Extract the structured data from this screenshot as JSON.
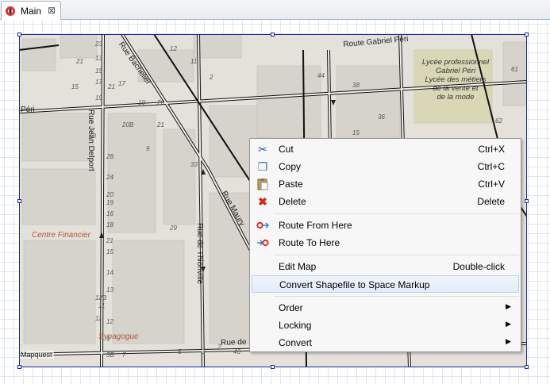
{
  "tab": {
    "label": "Main",
    "close": "⊠"
  },
  "map": {
    "labels": {
      "centre_financier": "Centre Financier",
      "synagogue": "Synagogue",
      "lycee": [
        "Lycée professionnel",
        "Gabriel Péri",
        "Lycée des métiers",
        "de la vente et",
        "de la mode"
      ],
      "mapquest": "Mapquest"
    },
    "streets": {
      "gabriel_peri": "Route Gabriel Péri",
      "jean_delport": "Rue Jean Delport",
      "thionville": "Rue de Thionville",
      "maury": "Rue Maury",
      "bachelier": "Rue Bachelier",
      "bottom": "Rue de",
      "peri_left": "Péri"
    },
    "numbers": [
      "23",
      "21",
      "15",
      "13",
      "15",
      "17",
      "19",
      "21",
      "17",
      "19",
      "20",
      "20B",
      "18",
      "28",
      "24",
      "20",
      "19",
      "16",
      "18",
      "21",
      "15",
      "14",
      "13",
      "11",
      "12",
      "12B",
      "11",
      "9",
      "3B",
      "7",
      "5",
      "3",
      "2",
      "46",
      "25",
      "28",
      "44",
      "38",
      "36",
      "15",
      "62",
      "61",
      "54",
      "48",
      "46",
      "9",
      "21",
      "12",
      "11",
      "2",
      "33",
      "29"
    ]
  },
  "menu": {
    "items": [
      {
        "label": "Cut",
        "accel": "Ctrl+X",
        "icon": "scissors-icon",
        "glyph": "✂"
      },
      {
        "label": "Copy",
        "accel": "Ctrl+C",
        "icon": "copy-icon",
        "glyph": "❐"
      },
      {
        "label": "Paste",
        "accel": "Ctrl+V",
        "icon": "paste-icon",
        "glyph": "📋"
      },
      {
        "label": "Delete",
        "accel": "Delete",
        "icon": "delete-icon",
        "glyph": "✖"
      },
      {
        "label": "Route From Here",
        "accel": "",
        "icon": "route-from-icon",
        "glyph": ""
      },
      {
        "label": "Route To Here",
        "accel": "",
        "icon": "route-to-icon",
        "glyph": ""
      },
      {
        "label": "Edit Map",
        "accel": "Double-click",
        "icon": "",
        "glyph": ""
      },
      {
        "label": "Convert Shapefile to Space Markup",
        "accel": "",
        "icon": "",
        "glyph": ""
      },
      {
        "label": "Order",
        "accel": "",
        "icon": "",
        "glyph": ""
      },
      {
        "label": "Locking",
        "accel": "",
        "icon": "",
        "glyph": ""
      },
      {
        "label": "Convert",
        "accel": "",
        "icon": "",
        "glyph": ""
      }
    ],
    "submenu_arrow": "▶"
  },
  "colors": {
    "selection_frame": "#1c2a9c",
    "menu_highlight": "#e3ecf8",
    "map_bg": "#e4e1db"
  }
}
